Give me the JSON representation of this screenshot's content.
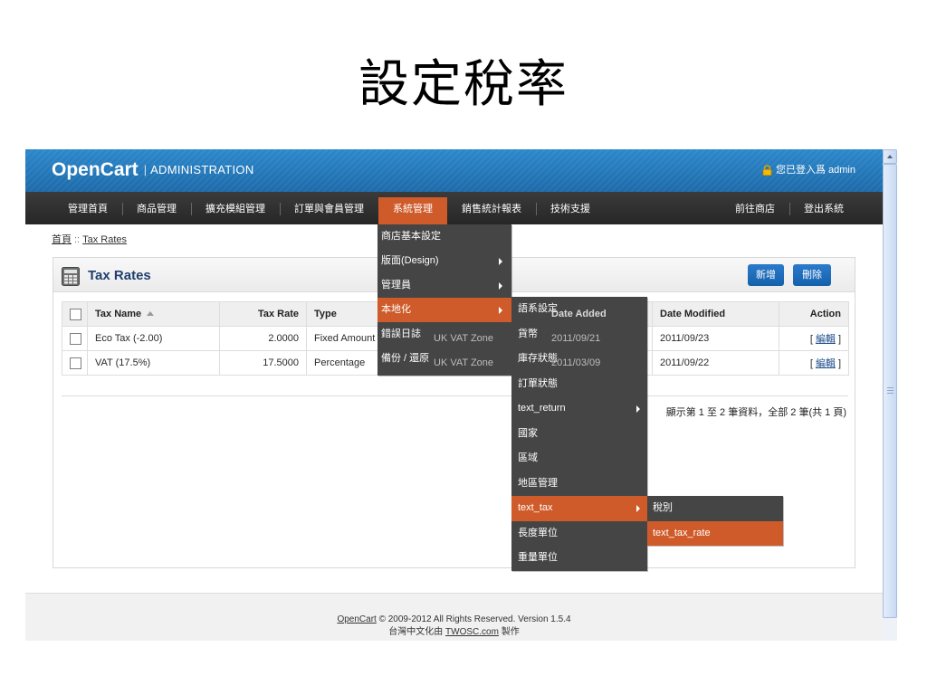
{
  "slide": {
    "title": "設定稅率"
  },
  "header": {
    "brand": "OpenCart",
    "divider": "|",
    "subtitle": "ADMINISTRATION",
    "login_status": "您已登入爲 admin",
    "lock_icon": "lock-icon"
  },
  "nav": {
    "items": [
      {
        "label": "管理首頁"
      },
      {
        "label": "商品管理"
      },
      {
        "label": "擴充模組管理"
      },
      {
        "label": "訂單與會員管理"
      },
      {
        "label": "系統管理",
        "active": true
      },
      {
        "label": "銷售統計報表"
      },
      {
        "label": "技術支援"
      }
    ],
    "right_items": [
      {
        "label": "前往商店"
      },
      {
        "label": "登出系統"
      }
    ]
  },
  "breadcrumb": {
    "home": "首頁",
    "separator": "::",
    "current": "Tax Rates"
  },
  "panel": {
    "icon": "calculator-icon",
    "title": "Tax Rates",
    "buttons": {
      "insert": "新增",
      "delete": "刪除"
    }
  },
  "table": {
    "columns": {
      "tax_name": {
        "label": "Tax Name",
        "sort_icon": "sort-asc-icon",
        "sorted_ascending": true
      },
      "tax_rate": {
        "label": "Tax Rate"
      },
      "type": {
        "label": "Type"
      },
      "date_added": {
        "label": "Date Added"
      },
      "date_modified": {
        "label": "Date Modified"
      },
      "action": {
        "label": "Action"
      }
    },
    "rows": [
      {
        "tax_name": "Eco Tax (-2.00)",
        "tax_rate": "2.0000",
        "type": "Fixed Amount",
        "geo_zone": "UK VAT Zone",
        "date_added": "2011/09/21",
        "date_modified": "2011/09/23",
        "action": "編輯"
      },
      {
        "tax_name": "VAT (17.5%)",
        "tax_rate": "17.5000",
        "type": "Percentage",
        "geo_zone": "UK VAT Zone",
        "date_added": "2011/03/09",
        "date_modified": "2011/09/22",
        "action": "編輯"
      }
    ],
    "action_open": "[",
    "action_close": "]"
  },
  "pagination": {
    "text": "顯示第 1 至 2 筆資料，全部 2 筆(共 1 頁)"
  },
  "footer": {
    "line1_link": "OpenCart",
    "line1_text": "© 2009-2012 All Rights Reserved. Version 1.5.4",
    "line2_prefix": "台灣中文化由",
    "line2_link": "TWOSC.com",
    "line2_suffix": "製作"
  },
  "menus": {
    "system": [
      {
        "label": "商店基本設定"
      },
      {
        "label": "版面(Design)",
        "submenu": true
      },
      {
        "label": "管理員",
        "submenu": true
      },
      {
        "label": "本地化",
        "submenu": true,
        "active": true
      },
      {
        "label": "錯誤日誌"
      },
      {
        "label": "備份 / 還原"
      }
    ],
    "localisation": [
      {
        "label": "語系設定"
      },
      {
        "label": "貨幣"
      },
      {
        "label": "庫存狀態"
      },
      {
        "label": "訂單狀態"
      },
      {
        "label": "text_return",
        "submenu": true
      },
      {
        "label": "國家"
      },
      {
        "label": "區域"
      },
      {
        "label": "地區管理"
      },
      {
        "label": "text_tax",
        "submenu": true,
        "active": true
      },
      {
        "label": "長度單位"
      },
      {
        "label": "重量單位"
      }
    ],
    "tax": [
      {
        "label": "稅別"
      },
      {
        "label": "text_tax_rate",
        "active": true
      }
    ]
  },
  "colors": {
    "header_blue": "#2479bb",
    "nav_dark": "#2e2e2e",
    "menu_bg": "#454545",
    "active_orange": "#cf5b2a",
    "button_blue": "#1a64b3",
    "heading_blue": "#20406f"
  }
}
